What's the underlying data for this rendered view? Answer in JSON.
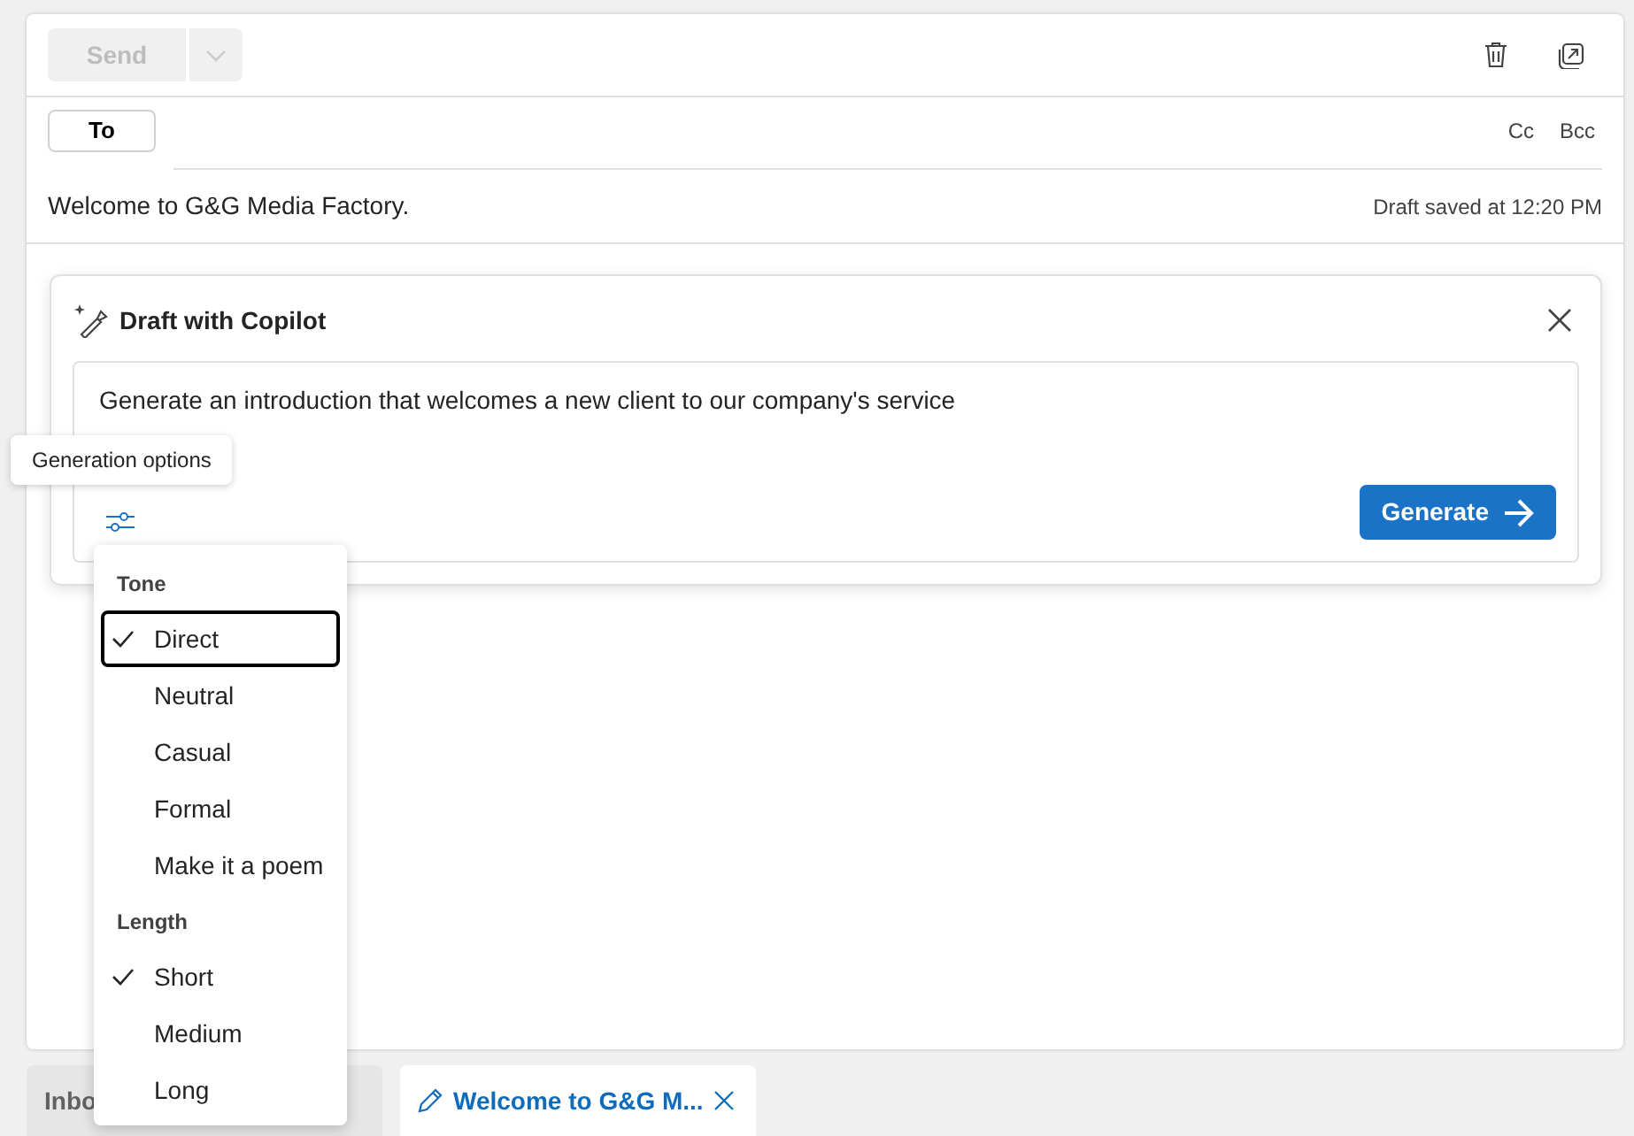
{
  "toolbar": {
    "send": {
      "label": "Send",
      "disabled": true
    }
  },
  "recipients": {
    "to": "To",
    "cc": "Cc",
    "bcc": "Bcc"
  },
  "subject": {
    "value": "Welcome to G&G Media Factory.",
    "status": "Draft saved at 12:20 PM"
  },
  "copilot": {
    "title": "Draft with Copilot",
    "prompt": "Generate an introduction that welcomes a new client to our company's service",
    "generate": "Generate"
  },
  "tooltip": "Generation options",
  "menu": {
    "groups": [
      {
        "title": "Tone",
        "options": [
          {
            "label": "Direct",
            "selected": true,
            "focused": true
          },
          {
            "label": "Neutral",
            "selected": false,
            "focused": false
          },
          {
            "label": "Casual",
            "selected": false,
            "focused": false
          },
          {
            "label": "Formal",
            "selected": false,
            "focused": false
          },
          {
            "label": "Make it a poem",
            "selected": false,
            "focused": false
          }
        ]
      },
      {
        "title": "Length",
        "options": [
          {
            "label": "Short",
            "selected": true,
            "focused": false
          },
          {
            "label": "Medium",
            "selected": false,
            "focused": false
          },
          {
            "label": "Long",
            "selected": false,
            "focused": false
          }
        ]
      }
    ]
  },
  "tabs": [
    {
      "label": "Inbo",
      "selected": false,
      "kind": "folder"
    },
    {
      "label": "Welcome to G&G M...",
      "selected": true,
      "kind": "draft"
    }
  ]
}
